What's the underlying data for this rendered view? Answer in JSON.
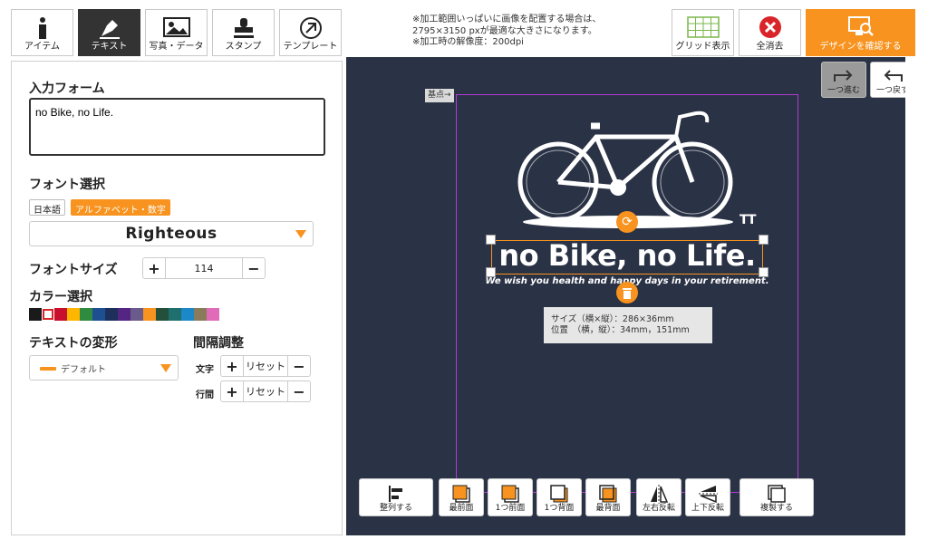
{
  "toolbar": {
    "tabs": [
      {
        "label": "アイテム",
        "icon": "info-icon"
      },
      {
        "label": "テキスト",
        "icon": "pen-icon",
        "active": true
      },
      {
        "label": "写真・データ",
        "icon": "image-icon"
      },
      {
        "label": "スタンプ",
        "icon": "stamp-icon"
      },
      {
        "label": "テンプレート",
        "icon": "template-icon"
      }
    ],
    "notice_lines": [
      "※加工範囲いっぱいに画像を配置する場合は、",
      "2795×3150 pxが最適な大きさになります。",
      "※加工時の解像度：200dpi"
    ],
    "grid_label": "グリッド表示",
    "clear_label": "全消去",
    "confirm_label": "デザインを確認する"
  },
  "panel": {
    "input_title": "入力フォーム",
    "input_value": "no Bike, no Life.",
    "font_title": "フォント選択",
    "font_tabs": [
      "日本語",
      "アルファベット・数字"
    ],
    "selected_font": "Righteous",
    "size_title": "フォントサイズ",
    "size_value": "114",
    "color_title": "カラー選択",
    "colors": [
      "#1a1a1a",
      "#ffffff",
      "#c8102e",
      "#ffb600",
      "#2e8b3f",
      "#1d4f91",
      "#1f2f5c",
      "#552583",
      "#6a5b8c",
      "#f7931e",
      "#244f3a",
      "#1f6f6f",
      "#1c88c7",
      "#8a7c5a",
      "#e06bb8"
    ],
    "deform_title": "テキストの変形",
    "deform_value": "デフォルト",
    "spacing_title": "間隔調整",
    "char_label": "文字",
    "line_label": "行間",
    "reset_label": "リセット"
  },
  "canvas": {
    "basepoint": "基点→",
    "design_text": "no Bike, no Life.",
    "subtitle": "We wish you health and happy days in your retirement.",
    "tt_mark": "TT",
    "info_size": "サイズ（横×縦）：286×36mm",
    "info_pos": "位置　（横，縦）：34mm，151mm",
    "redo_label": "一つ進む",
    "undo_label": "一つ戻す",
    "actions": [
      "整列する",
      "最前面",
      "1つ前面",
      "1つ背面",
      "最背面",
      "左右反転",
      "上下反転",
      "複製する"
    ]
  },
  "colors": {
    "accent": "#f7931e",
    "canvas_bg": "#2a3245",
    "print_border": "#b23bd6"
  }
}
